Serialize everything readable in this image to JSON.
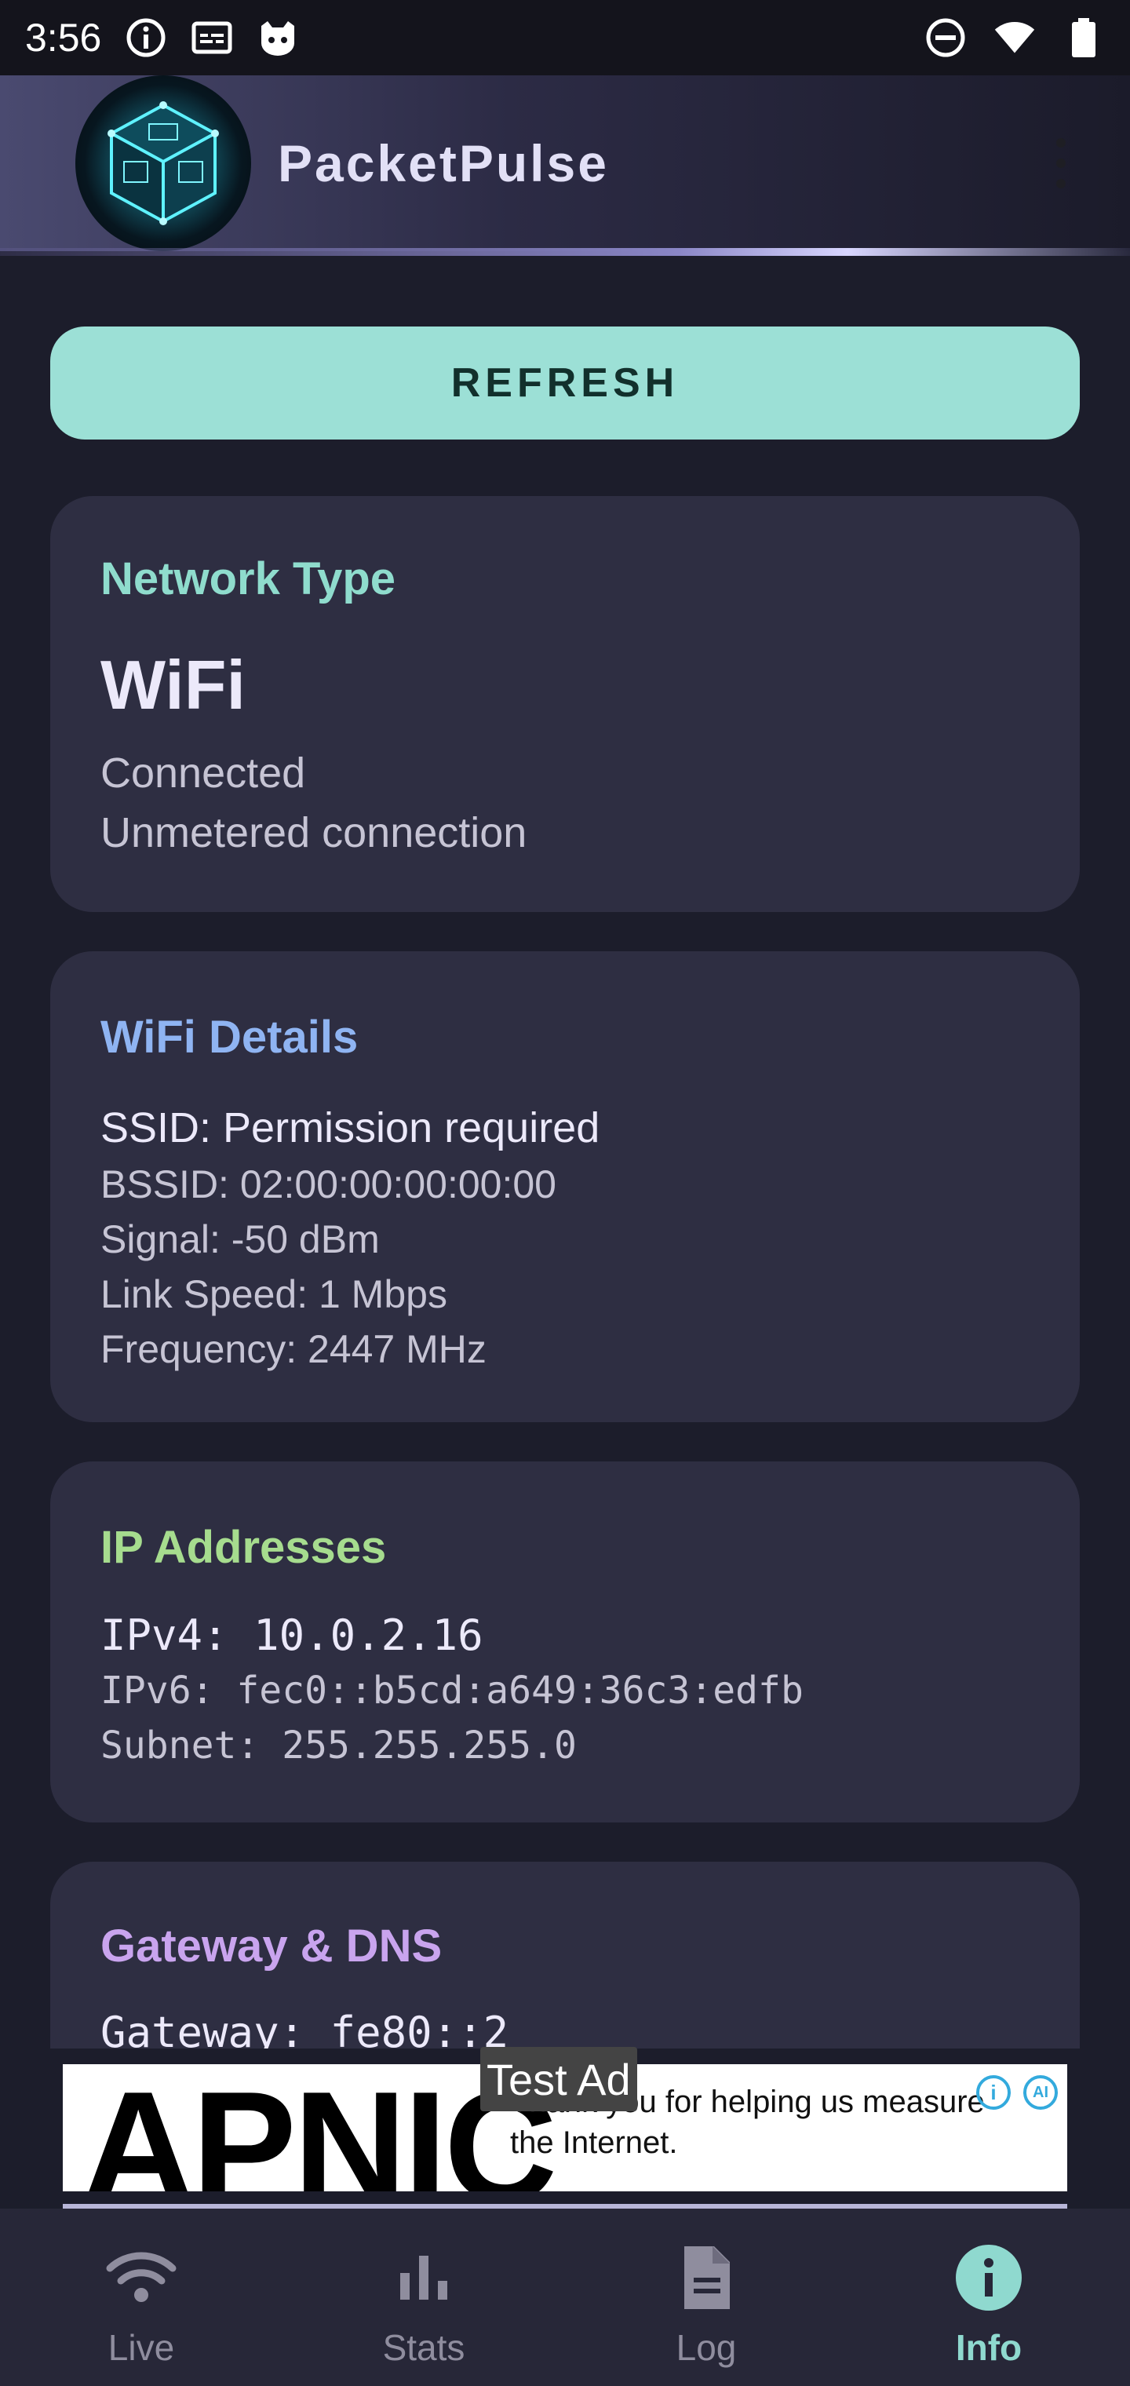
{
  "status_bar": {
    "time": "3:56"
  },
  "app_bar": {
    "title": "PacketPulse"
  },
  "refresh_label": "REFRESH",
  "network_type": {
    "title": "Network Type",
    "title_color": "#8fdccd",
    "value": "WiFi",
    "status": "Connected",
    "metering": "Unmetered connection"
  },
  "wifi_details": {
    "title": "WiFi Details",
    "title_color": "#8fb4f2",
    "ssid": "SSID: Permission required",
    "bssid": "BSSID: 02:00:00:00:00:00",
    "signal": "Signal: -50 dBm",
    "link_speed": "Link Speed: 1 Mbps",
    "frequency": "Frequency: 2447 MHz"
  },
  "ip_addresses": {
    "title": "IP Addresses",
    "title_color": "#a6dc8e",
    "ipv4": "IPv4: 10.0.2.16",
    "ipv6": "IPv6: fec0::b5cd:a649:36c3:edfb",
    "subnet": "Subnet: 255.255.255.0"
  },
  "gateway_dns": {
    "title": "Gateway & DNS",
    "title_color": "#c9a4ee",
    "gateway": "Gateway: fe80::2"
  },
  "ad": {
    "badge": "Test Ad",
    "logo_text": "APNIC",
    "text": "Thank you for helping us measure the Internet."
  },
  "bottom_nav": {
    "items": [
      {
        "label": "Live",
        "icon": "wifi-icon",
        "active": false
      },
      {
        "label": "Stats",
        "icon": "bar-chart-icon",
        "active": false
      },
      {
        "label": "Log",
        "icon": "document-icon",
        "active": false
      },
      {
        "label": "Info",
        "icon": "info-icon",
        "active": true
      }
    ],
    "active_color": "#8fd9cf"
  }
}
